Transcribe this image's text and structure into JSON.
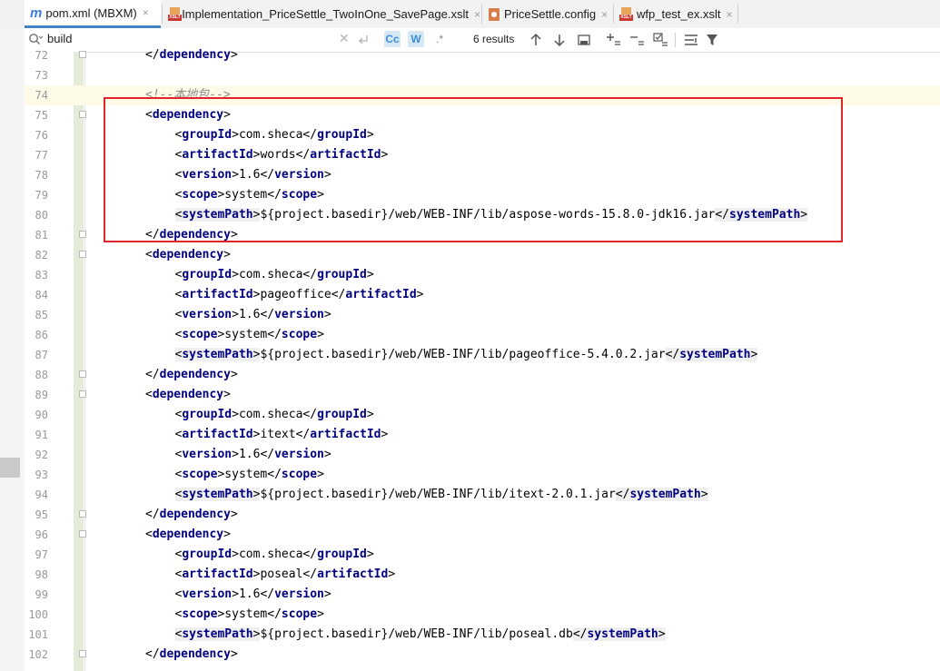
{
  "tabs": [
    {
      "label": "pom.xml (MBXM)",
      "icon": "maven-icon",
      "active": true
    },
    {
      "label": "Implementation_PriceSettle_TwoInOne_SavePage.xslt",
      "icon": "xslt-icon",
      "active": false
    },
    {
      "label": "PriceSettle.config",
      "icon": "config-icon",
      "active": false
    },
    {
      "label": "wfp_test_ex.xslt",
      "icon": "xslt-icon",
      "active": false
    }
  ],
  "tab_icon_text": {
    "maven": "m",
    "xslt": "XSLT",
    "close": "×"
  },
  "search": {
    "query": "build",
    "results": "6 results",
    "match_case": "Cc",
    "words": "W",
    "regex": ".*"
  },
  "colors": {
    "tag": "#000080",
    "comment": "#8c8c8c",
    "highlight_box": "#e0262b",
    "active_tab": "#4083c9"
  },
  "lines": [
    {
      "n": "72",
      "indent": 1,
      "parts": [
        {
          "t": "tag",
          "v": "dependency",
          "close": true
        }
      ],
      "fold": true
    },
    {
      "n": "73",
      "indent": 0,
      "parts": []
    },
    {
      "n": "74",
      "indent": 1,
      "parts": [
        {
          "t": "comment",
          "v": "<!--本地包-->"
        }
      ],
      "highlight": true
    },
    {
      "n": "75",
      "indent": 1,
      "parts": [
        {
          "t": "tag",
          "v": "dependency"
        }
      ],
      "fold": true
    },
    {
      "n": "76",
      "indent": 2,
      "parts": [
        {
          "t": "tag",
          "v": "groupId"
        },
        {
          "t": "text",
          "v": "com.sheca"
        },
        {
          "t": "tag",
          "v": "groupId",
          "close": true
        }
      ]
    },
    {
      "n": "77",
      "indent": 2,
      "parts": [
        {
          "t": "tag",
          "v": "artifactId"
        },
        {
          "t": "text",
          "v": "words"
        },
        {
          "t": "tag",
          "v": "artifactId",
          "close": true
        }
      ]
    },
    {
      "n": "78",
      "indent": 2,
      "parts": [
        {
          "t": "tag",
          "v": "version"
        },
        {
          "t": "text",
          "v": "1.6"
        },
        {
          "t": "tag",
          "v": "version",
          "close": true
        }
      ]
    },
    {
      "n": "79",
      "indent": 2,
      "parts": [
        {
          "t": "tag",
          "v": "scope"
        },
        {
          "t": "text",
          "v": "system"
        },
        {
          "t": "tag",
          "v": "scope",
          "close": true
        }
      ]
    },
    {
      "n": "80",
      "indent": 2,
      "parts": [
        {
          "t": "tag",
          "v": "systemPath",
          "shade": true
        },
        {
          "t": "text",
          "v": "${project.basedir}/web/WEB-INF/lib/aspose-words-15.8.0-jdk16.jar"
        },
        {
          "t": "tag",
          "v": "systemPath",
          "close": true,
          "shade": true
        }
      ]
    },
    {
      "n": "81",
      "indent": 1,
      "parts": [
        {
          "t": "tag",
          "v": "dependency",
          "close": true
        }
      ],
      "fold": true
    },
    {
      "n": "82",
      "indent": 1,
      "parts": [
        {
          "t": "tag",
          "v": "dependency"
        }
      ],
      "fold": true
    },
    {
      "n": "83",
      "indent": 2,
      "parts": [
        {
          "t": "tag",
          "v": "groupId"
        },
        {
          "t": "text",
          "v": "com.sheca"
        },
        {
          "t": "tag",
          "v": "groupId",
          "close": true
        }
      ]
    },
    {
      "n": "84",
      "indent": 2,
      "parts": [
        {
          "t": "tag",
          "v": "artifactId"
        },
        {
          "t": "text",
          "v": "pageoffice"
        },
        {
          "t": "tag",
          "v": "artifactId",
          "close": true
        }
      ]
    },
    {
      "n": "85",
      "indent": 2,
      "parts": [
        {
          "t": "tag",
          "v": "version"
        },
        {
          "t": "text",
          "v": "1.6"
        },
        {
          "t": "tag",
          "v": "version",
          "close": true
        }
      ]
    },
    {
      "n": "86",
      "indent": 2,
      "parts": [
        {
          "t": "tag",
          "v": "scope"
        },
        {
          "t": "text",
          "v": "system"
        },
        {
          "t": "tag",
          "v": "scope",
          "close": true
        }
      ]
    },
    {
      "n": "87",
      "indent": 2,
      "parts": [
        {
          "t": "tag",
          "v": "systemPath",
          "shade": true
        },
        {
          "t": "text",
          "v": "${project.basedir}/web/WEB-INF/lib/pageoffice-5.4.0.2.jar"
        },
        {
          "t": "tag",
          "v": "systemPath",
          "close": true,
          "shade": true
        }
      ]
    },
    {
      "n": "88",
      "indent": 1,
      "parts": [
        {
          "t": "tag",
          "v": "dependency",
          "close": true
        }
      ],
      "fold": true
    },
    {
      "n": "89",
      "indent": 1,
      "parts": [
        {
          "t": "tag",
          "v": "dependency"
        }
      ],
      "fold": true
    },
    {
      "n": "90",
      "indent": 2,
      "parts": [
        {
          "t": "tag",
          "v": "groupId"
        },
        {
          "t": "text",
          "v": "com.sheca"
        },
        {
          "t": "tag",
          "v": "groupId",
          "close": true
        }
      ]
    },
    {
      "n": "91",
      "indent": 2,
      "parts": [
        {
          "t": "tag",
          "v": "artifactId"
        },
        {
          "t": "text",
          "v": "itext"
        },
        {
          "t": "tag",
          "v": "artifactId",
          "close": true
        }
      ]
    },
    {
      "n": "92",
      "indent": 2,
      "parts": [
        {
          "t": "tag",
          "v": "version"
        },
        {
          "t": "text",
          "v": "1.6"
        },
        {
          "t": "tag",
          "v": "version",
          "close": true
        }
      ]
    },
    {
      "n": "93",
      "indent": 2,
      "parts": [
        {
          "t": "tag",
          "v": "scope"
        },
        {
          "t": "text",
          "v": "system"
        },
        {
          "t": "tag",
          "v": "scope",
          "close": true
        }
      ]
    },
    {
      "n": "94",
      "indent": 2,
      "parts": [
        {
          "t": "tag",
          "v": "systemPath",
          "shade": true
        },
        {
          "t": "text",
          "v": "${project.basedir}/web/WEB-INF/lib/itext-2.0.1.jar"
        },
        {
          "t": "tag",
          "v": "systemPath",
          "close": true,
          "shade": true
        }
      ]
    },
    {
      "n": "95",
      "indent": 1,
      "parts": [
        {
          "t": "tag",
          "v": "dependency",
          "close": true
        }
      ],
      "fold": true
    },
    {
      "n": "96",
      "indent": 1,
      "parts": [
        {
          "t": "tag",
          "v": "dependency"
        }
      ],
      "fold": true
    },
    {
      "n": "97",
      "indent": 2,
      "parts": [
        {
          "t": "tag",
          "v": "groupId"
        },
        {
          "t": "text",
          "v": "com.sheca"
        },
        {
          "t": "tag",
          "v": "groupId",
          "close": true
        }
      ]
    },
    {
      "n": "98",
      "indent": 2,
      "parts": [
        {
          "t": "tag",
          "v": "artifactId"
        },
        {
          "t": "text",
          "v": "poseal"
        },
        {
          "t": "tag",
          "v": "artifactId",
          "close": true
        }
      ]
    },
    {
      "n": "99",
      "indent": 2,
      "parts": [
        {
          "t": "tag",
          "v": "version"
        },
        {
          "t": "text",
          "v": "1.6"
        },
        {
          "t": "tag",
          "v": "version",
          "close": true
        }
      ]
    },
    {
      "n": "100",
      "indent": 2,
      "parts": [
        {
          "t": "tag",
          "v": "scope"
        },
        {
          "t": "text",
          "v": "system"
        },
        {
          "t": "tag",
          "v": "scope",
          "close": true
        }
      ]
    },
    {
      "n": "101",
      "indent": 2,
      "parts": [
        {
          "t": "tag",
          "v": "systemPath",
          "shade": true
        },
        {
          "t": "text",
          "v": "${project.basedir}/web/WEB-INF/lib/poseal.db"
        },
        {
          "t": "tag",
          "v": "systemPath",
          "close": true,
          "shade": true
        }
      ]
    },
    {
      "n": "102",
      "indent": 1,
      "parts": [
        {
          "t": "tag",
          "v": "dependency",
          "close": true
        }
      ],
      "fold": true
    }
  ]
}
